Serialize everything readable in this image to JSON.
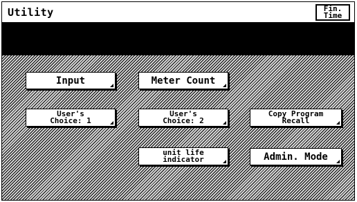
{
  "header": {
    "title": "Utility",
    "fin_time_line1": "Fin.",
    "fin_time_line2": "Time"
  },
  "buttons": {
    "input": "Input",
    "meter_count": "Meter Count",
    "users_choice_1_line1": "User's",
    "users_choice_1_line2": "Choice: 1",
    "users_choice_2_line1": "User's",
    "users_choice_2_line2": "Choice: 2",
    "copy_program_recall_line1": "Copy Program",
    "copy_program_recall_line2": "Recall",
    "unit_life_line1": "unit life",
    "unit_life_line2": "indicator",
    "admin_mode": "Admin. Mode"
  }
}
